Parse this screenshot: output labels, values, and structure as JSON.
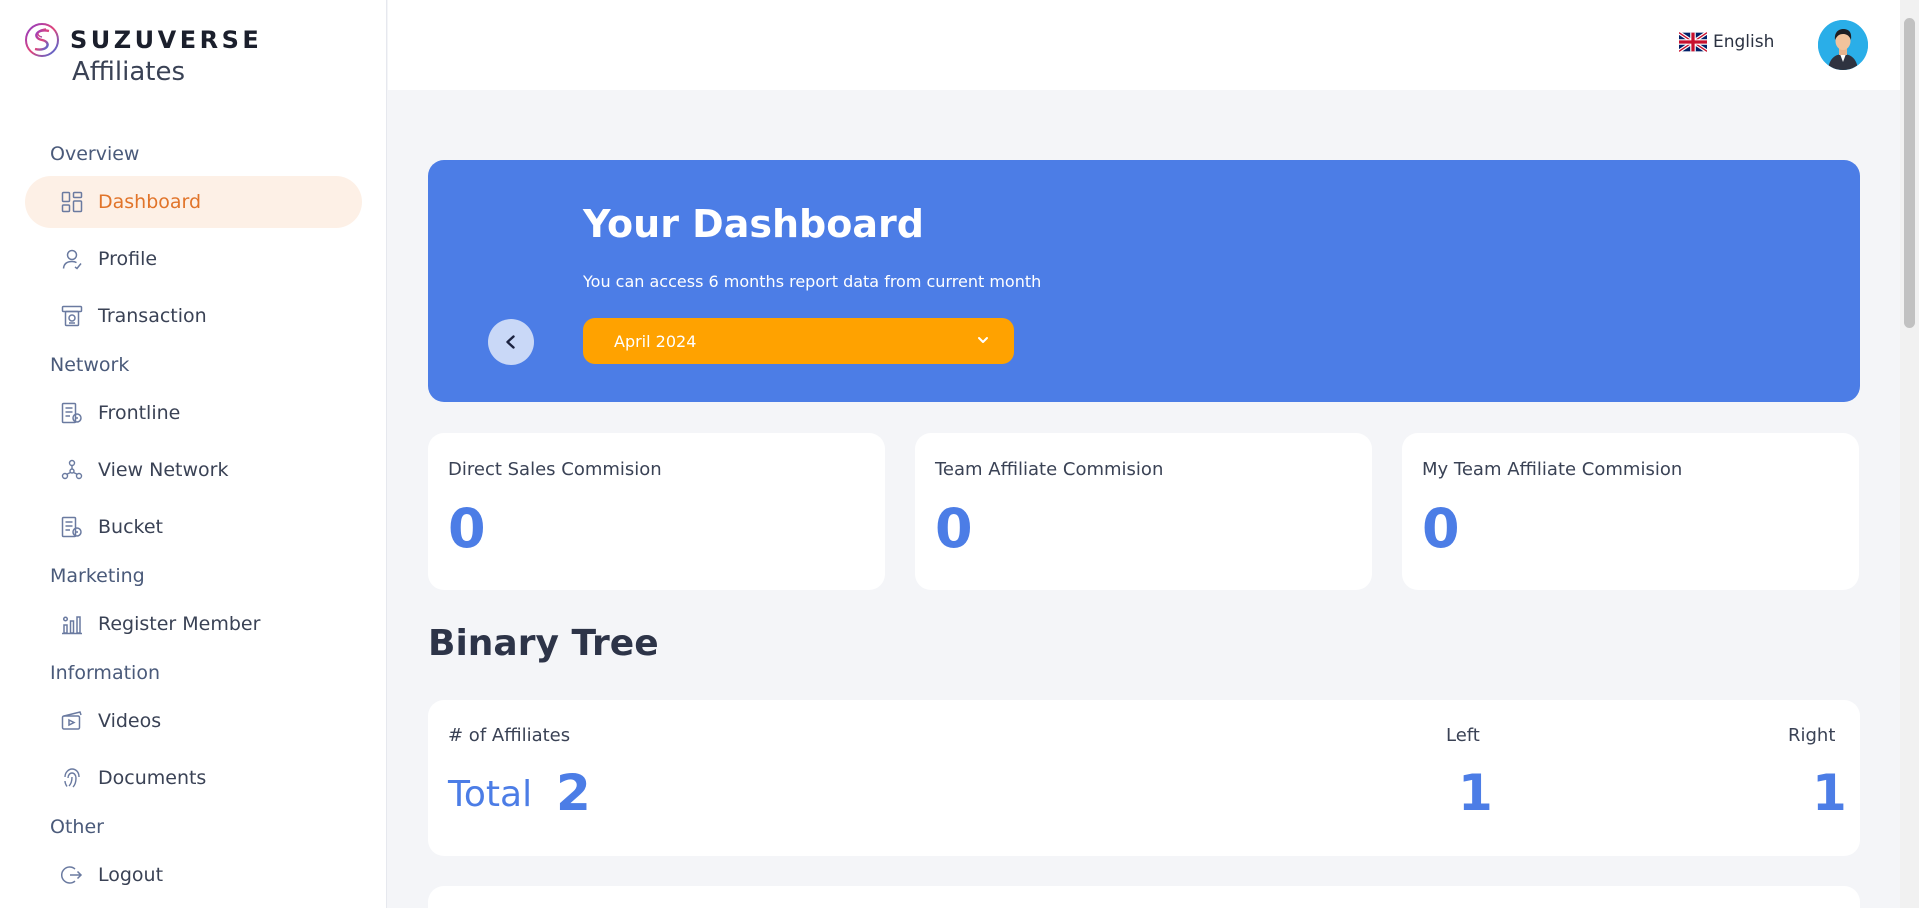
{
  "brand": {
    "name": "SUZUVERSE",
    "sub": "Affiliates"
  },
  "sidebar": {
    "sections": [
      {
        "title": "Overview"
      },
      {
        "title": "Network"
      },
      {
        "title": "Marketing"
      },
      {
        "title": "Information"
      },
      {
        "title": "Other"
      }
    ],
    "items": [
      {
        "label": "Dashboard",
        "icon": "dashboard-icon",
        "active": true
      },
      {
        "label": "Profile",
        "icon": "user-icon"
      },
      {
        "label": "Transaction",
        "icon": "atm-icon"
      },
      {
        "label": "Frontline",
        "icon": "building-icon"
      },
      {
        "label": "View Network",
        "icon": "network-icon"
      },
      {
        "label": "Bucket",
        "icon": "building-icon"
      },
      {
        "label": "Register Member",
        "icon": "chart-icon"
      },
      {
        "label": "Videos",
        "icon": "video-icon"
      },
      {
        "label": "Documents",
        "icon": "fingerprint-icon"
      },
      {
        "label": "Logout",
        "icon": "logout-icon"
      }
    ],
    "active_color": "#e1742a"
  },
  "topbar": {
    "language": "English"
  },
  "hero": {
    "title": "Your Dashboard",
    "subtitle": "You can access 6 months report data from current month",
    "selected_month": "April 2024",
    "bg_color": "#4c7de6",
    "select_color": "#ffa200"
  },
  "stats": [
    {
      "title": "Direct Sales Commision",
      "value": "0"
    },
    {
      "title": "Team Affiliate Commision",
      "value": "0"
    },
    {
      "title": "My Team Affiliate Commision",
      "value": "0"
    }
  ],
  "binary_tree": {
    "heading": "Binary Tree",
    "affiliates_label": "# of Affiliates",
    "total_label": "Total",
    "total_value": "2",
    "left_label": "Left",
    "left_value": "1",
    "right_label": "Right",
    "right_value": "1"
  }
}
